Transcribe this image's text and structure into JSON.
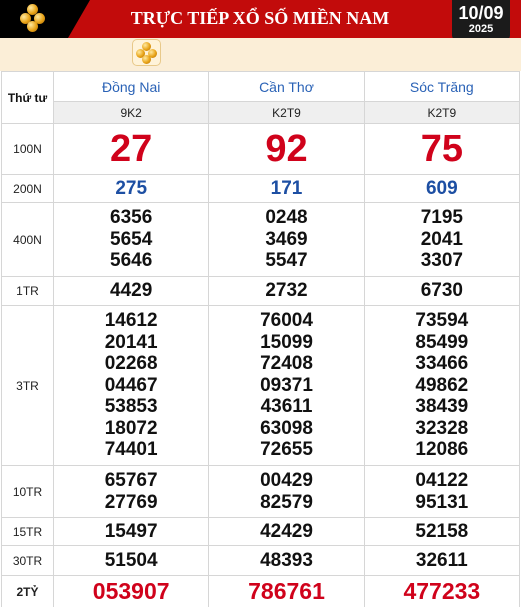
{
  "header": {
    "title": "TRỰC TIẾP XỔ SỐ MIỀN NAM",
    "date_day": "10/09",
    "date_year": "2025",
    "logo_icon": "coins-icon",
    "brand_color": "#c20b0b"
  },
  "table": {
    "day_label": "Thứ tư",
    "provinces": [
      {
        "name": "Đồng Nai",
        "code": "9K2"
      },
      {
        "name": "Cần Thơ",
        "code": "K2T9"
      },
      {
        "name": "Sóc Trăng",
        "code": "K2T9"
      }
    ],
    "prizes": [
      {
        "label": "100N",
        "values": [
          [
            "27"
          ],
          [
            "92"
          ],
          [
            "75"
          ]
        ]
      },
      {
        "label": "200N",
        "values": [
          [
            "275"
          ],
          [
            "171"
          ],
          [
            "609"
          ]
        ]
      },
      {
        "label": "400N",
        "values": [
          [
            "6356",
            "5654",
            "5646"
          ],
          [
            "0248",
            "3469",
            "5547"
          ],
          [
            "7195",
            "2041",
            "3307"
          ]
        ]
      },
      {
        "label": "1TR",
        "values": [
          [
            "4429"
          ],
          [
            "2732"
          ],
          [
            "6730"
          ]
        ]
      },
      {
        "label": "3TR",
        "values": [
          [
            "14612",
            "20141",
            "02268",
            "04467",
            "53853",
            "18072",
            "74401"
          ],
          [
            "76004",
            "15099",
            "72408",
            "09371",
            "43611",
            "63098",
            "72655"
          ],
          [
            "73594",
            "85499",
            "33466",
            "49862",
            "38439",
            "32328",
            "12086"
          ]
        ]
      },
      {
        "label": "10TR",
        "values": [
          [
            "65767",
            "27769"
          ],
          [
            "00429",
            "82579"
          ],
          [
            "04122",
            "95131"
          ]
        ]
      },
      {
        "label": "15TR",
        "values": [
          [
            "15497"
          ],
          [
            "42429"
          ],
          [
            "52158"
          ]
        ]
      },
      {
        "label": "30TR",
        "values": [
          [
            "51504"
          ],
          [
            "48393"
          ],
          [
            "32611"
          ]
        ]
      },
      {
        "label": "2TỶ",
        "values": [
          [
            "053907"
          ],
          [
            "786761"
          ],
          [
            "477233"
          ]
        ]
      }
    ]
  }
}
